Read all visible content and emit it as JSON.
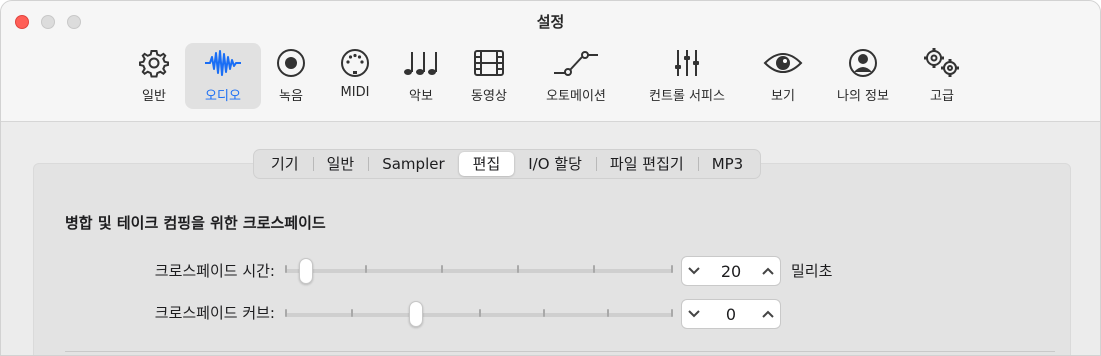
{
  "window": {
    "title": "설정"
  },
  "toolbar": {
    "items": [
      {
        "label": "일반",
        "icon": "gear-icon"
      },
      {
        "label": "오디오",
        "icon": "waveform-icon"
      },
      {
        "label": "녹음",
        "icon": "record-icon"
      },
      {
        "label": "MIDI",
        "icon": "midi-connector-icon"
      },
      {
        "label": "악보",
        "icon": "music-notes-icon"
      },
      {
        "label": "동영상",
        "icon": "film-icon"
      },
      {
        "label": "오토메이션",
        "icon": "automation-curve-icon"
      },
      {
        "label": "컨트롤 서피스",
        "icon": "faders-icon"
      },
      {
        "label": "보기",
        "icon": "eye-icon"
      },
      {
        "label": "나의 정보",
        "icon": "person-icon"
      },
      {
        "label": "고급",
        "icon": "gears-icon"
      }
    ],
    "selected": "오디오",
    "accent_color": "#1a6ef5"
  },
  "tabs": {
    "items": [
      "기기",
      "일반",
      "Sampler",
      "편집",
      "I/O 할당",
      "파일 편집기",
      "MP3"
    ],
    "active": "편집"
  },
  "section": {
    "title": "병합 및 테이크 컴핑을 위한 크로스페이드",
    "rows": [
      {
        "label": "크로스페이드 시간:",
        "value": "20",
        "unit": "밀리초",
        "slider_fraction": 0.02
      },
      {
        "label": "크로스페이드 커브:",
        "value": "0",
        "unit": "",
        "slider_fraction": 0.33
      }
    ]
  }
}
